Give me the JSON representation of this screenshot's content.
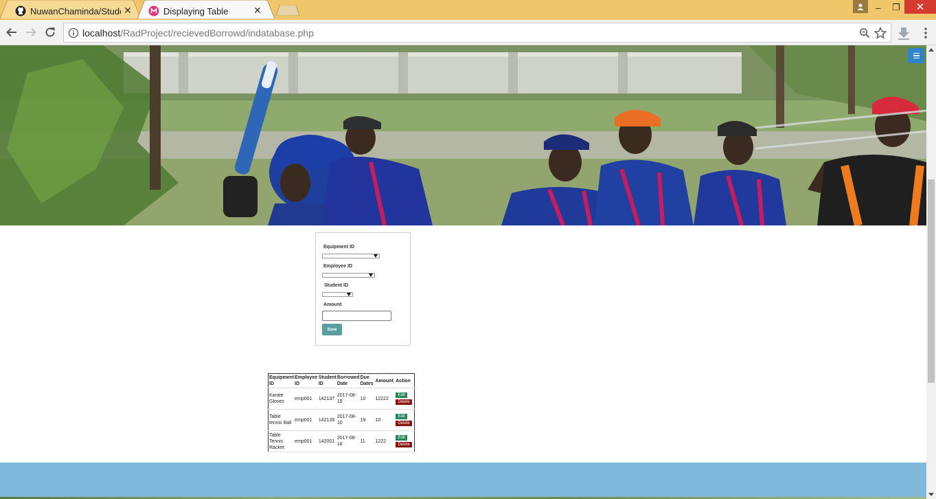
{
  "browser": {
    "tabs": [
      {
        "title": "NuwanChaminda/Studen",
        "favicon": "github-icon",
        "active": false
      },
      {
        "title": "Displaying Table",
        "favicon": "page-icon",
        "active": true
      }
    ],
    "tab_close_glyph": "✕",
    "url": {
      "host": "localhost",
      "path": "/RadProject/recievedBorrowd/indatabase.php"
    },
    "window_controls": {
      "minimize": "–",
      "maximize": "❐",
      "close": "✕"
    },
    "colors": {
      "titlebar": "#efc66a",
      "close": "#d43a2f"
    }
  },
  "form": {
    "equipment_label": "Equipment ID",
    "employee_label": "Employee ID",
    "student_label": "Student ID",
    "amount_label": "Amount",
    "amount_value": "",
    "save_label": "Save"
  },
  "table": {
    "headers": [
      [
        "Equipment",
        "ID"
      ],
      [
        "Employee",
        "ID"
      ],
      [
        "Student",
        "ID"
      ],
      [
        "Borrowed",
        "Date"
      ],
      [
        "Due",
        "Dates"
      ],
      [
        "Amount"
      ],
      [
        "Action"
      ]
    ],
    "rows": [
      {
        "equipment": [
          "Karate",
          "Gloves"
        ],
        "employee": "emp001",
        "student": "142137",
        "borrowed": [
          "2017-08-",
          "15"
        ],
        "due": "10",
        "amount": "12222"
      },
      {
        "equipment": [
          "Table",
          "tennis Ball"
        ],
        "employee": "emp001",
        "student": "142139",
        "borrowed": [
          "2017-08-",
          "10"
        ],
        "due": "19",
        "amount": "10"
      },
      {
        "equipment": [
          "Table",
          "Tennis",
          "Racket"
        ],
        "employee": "emp001",
        "student": "142001",
        "borrowed": [
          "2017-08-",
          "18"
        ],
        "due": "11",
        "amount": "1222"
      }
    ],
    "edit_label": "Edit",
    "delete_label": "Delete",
    "colors": {
      "edit": "#27855b",
      "delete": "#8a1212",
      "save": "#5b9ea2"
    }
  },
  "footer": {
    "color": "#7fb8db"
  }
}
